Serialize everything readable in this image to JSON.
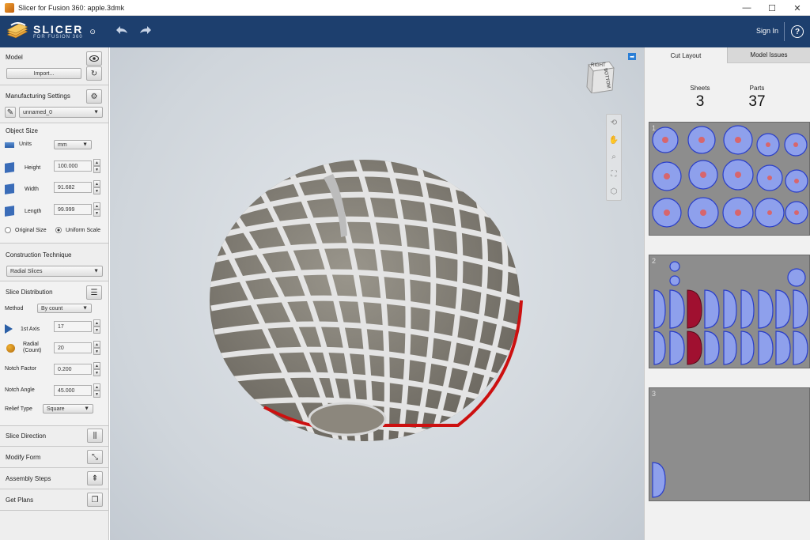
{
  "window": {
    "title": "Slicer for Fusion 360: apple.3dmk",
    "minimize": "—",
    "maximize": "☐",
    "close": "✕"
  },
  "appbar": {
    "logo_text": "SLICER",
    "logo_subtext": "FOR FUSION 360",
    "sign_in": "Sign In",
    "help": "?"
  },
  "left": {
    "model": {
      "title": "Model",
      "import_label": "Import..."
    },
    "manufacturing": {
      "title": "Manufacturing Settings",
      "preset": "unnamed_0"
    },
    "object_size": {
      "title": "Object Size",
      "units_label": "Units",
      "units_value": "mm",
      "height_label": "Height",
      "height_value": "100.000",
      "width_label": "Width",
      "width_value": "91.682",
      "length_label": "Length",
      "length_value": "99.999",
      "original_size": "Original Size",
      "uniform_scale": "Uniform Scale"
    },
    "construction": {
      "title": "Construction Technique",
      "value": "Radial Slices"
    },
    "distribution": {
      "title": "Slice Distribution",
      "method_label": "Method",
      "method_value": "By count",
      "axis1_label": "1st Axis",
      "axis1_value": "17",
      "radial_label": "Radial",
      "radial_sub": "(Count)",
      "radial_value": "20",
      "notch_factor_label": "Notch Factor",
      "notch_factor_value": "0.200",
      "notch_angle_label": "Notch Angle",
      "notch_angle_value": "45.000",
      "relief_label": "Relief Type",
      "relief_value": "Square"
    },
    "bottom_items": [
      {
        "label": "Slice Direction"
      },
      {
        "label": "Modify Form"
      },
      {
        "label": "Assembly Steps"
      },
      {
        "label": "Get Plans"
      }
    ]
  },
  "viewcube": {
    "top": "RIGHT",
    "side": "BOTTOM"
  },
  "right": {
    "tabs": {
      "cut_layout": "Cut Layout",
      "model_issues": "Model Issues"
    },
    "sheets_label": "Sheets",
    "sheets_value": "3",
    "parts_label": "Parts",
    "parts_value": "37",
    "sheet_numbers": [
      "1",
      "2",
      "3"
    ]
  },
  "colors": {
    "appbar": "#1d3f6e",
    "part_fill": "#8ea0ec",
    "part_stroke": "#2a3ec8",
    "highlight_red": "#d01010"
  }
}
